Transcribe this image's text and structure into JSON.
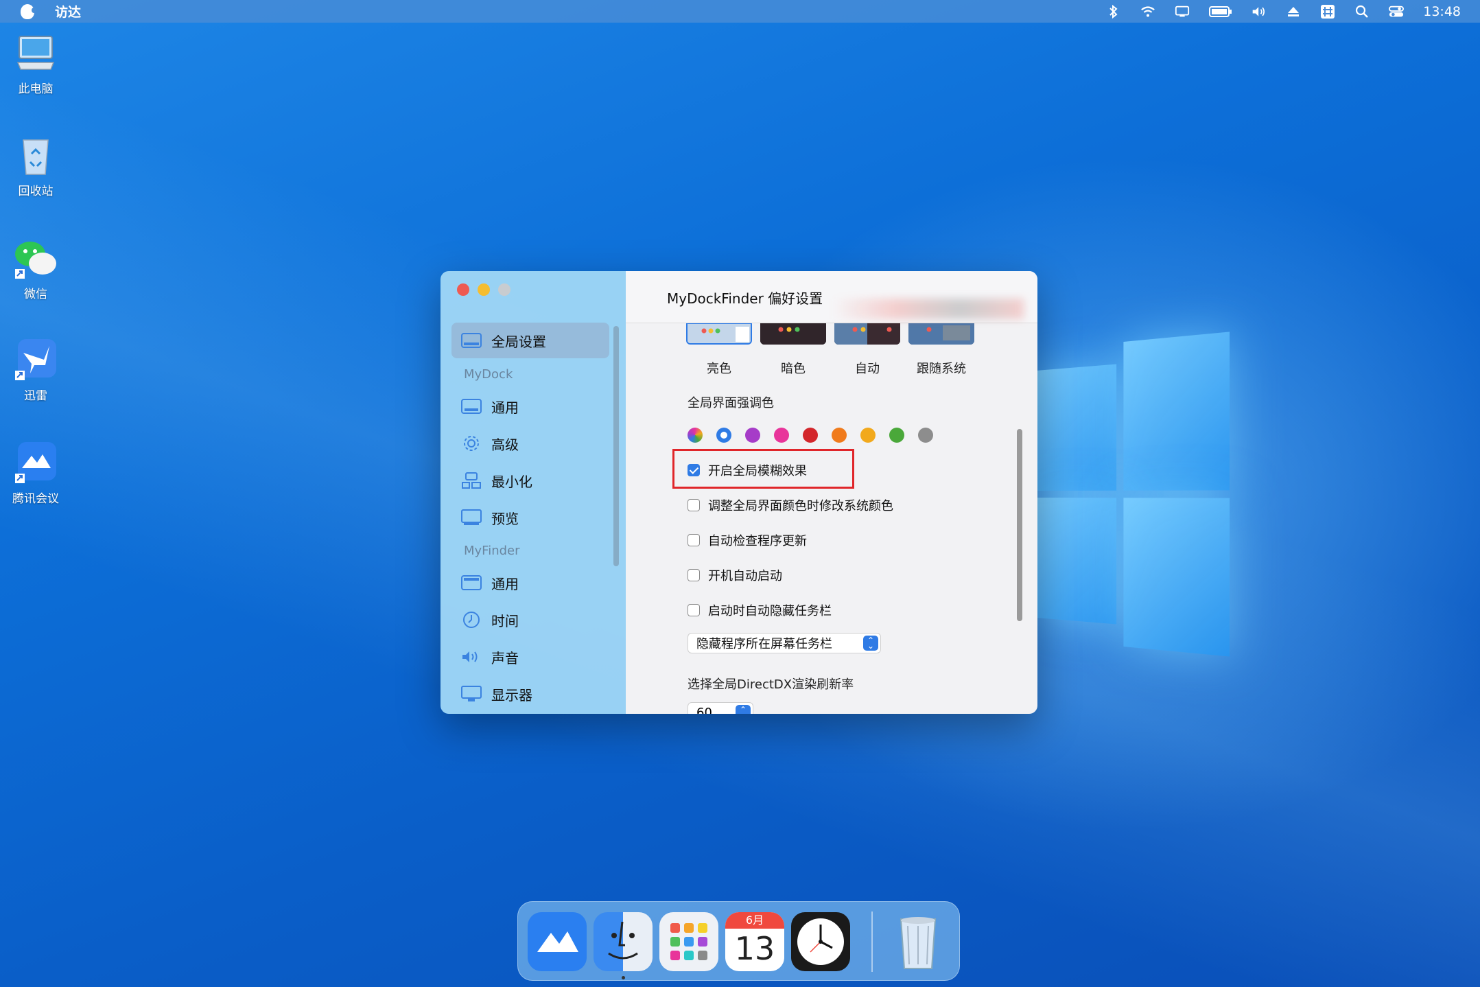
{
  "menubar": {
    "app_name": "访达",
    "time": "13:48"
  },
  "desktop": {
    "icons": [
      {
        "label": "此电脑"
      },
      {
        "label": "回收站"
      },
      {
        "label": "微信"
      },
      {
        "label": "迅雷"
      },
      {
        "label": "腾讯会议"
      }
    ]
  },
  "window": {
    "title": "MyDockFinder 偏好设置",
    "sidebar": {
      "global": "全局设置",
      "section_mydock": "MyDock",
      "mydock_items": [
        "通用",
        "高级",
        "最小化",
        "预览"
      ],
      "section_myfinder": "MyFinder",
      "myfinder_items": [
        "通用",
        "时间",
        "声音",
        "显示器"
      ]
    },
    "themes": [
      "亮色",
      "暗色",
      "自动",
      "跟随系统"
    ],
    "accent_label": "全局界面强调色",
    "accent_colors": [
      "#multicolor",
      "#2f7be5",
      "#a63cc8",
      "#e8349a",
      "#d3262b",
      "#f07b1c",
      "#f2a91c",
      "#4aa83a",
      "#8d8d8d"
    ],
    "checkboxes": [
      {
        "label": "开启全局模糊效果",
        "checked": true
      },
      {
        "label": "调整全局界面颜色时修改系统颜色",
        "checked": false
      },
      {
        "label": "自动检查程序更新",
        "checked": false
      },
      {
        "label": "开机自动启动",
        "checked": false
      },
      {
        "label": "启动时自动隐藏任务栏",
        "checked": false
      }
    ],
    "taskbar_select": "隐藏程序所在屏幕任务栏",
    "refresh_label": "选择全局DirectDX渲染刷新率",
    "refresh_value": "60"
  },
  "dock": {
    "calendar_month": "6月",
    "calendar_day": "13"
  }
}
